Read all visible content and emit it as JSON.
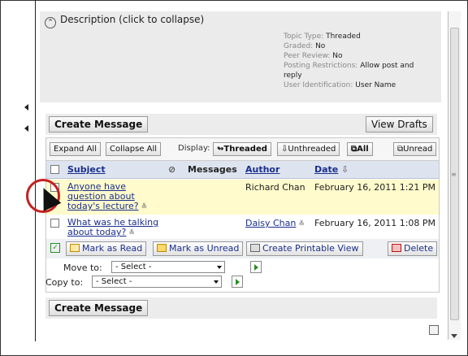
{
  "description": {
    "header": "Description (click to collapse)",
    "meta": [
      {
        "label": "Topic Type:",
        "value": "Threaded"
      },
      {
        "label": "Graded:",
        "value": "No"
      },
      {
        "label": "Peer Review:",
        "value": "No"
      },
      {
        "label": "Posting Restrictions:",
        "value": "Allow post and reply"
      },
      {
        "label": "User Identification:",
        "value": "User Name"
      }
    ]
  },
  "top_bar": {
    "create_label": "Create Message",
    "drafts_label": "View Drafts"
  },
  "toolbar": {
    "expand_all": "Expand All",
    "collapse_all": "Collapse All",
    "display_label": "Display:",
    "threaded": "Threaded",
    "unthreaded": "Unthreaded",
    "all": "All",
    "unread": "Unread"
  },
  "table": {
    "headers": {
      "subject": "Subject",
      "messages": "Messages",
      "author": "Author",
      "date": "Date"
    },
    "rows": [
      {
        "subject": "Anyone have question about today's lecture?",
        "author": "Richard Chan",
        "date": "February 16, 2011 1:21 PM"
      },
      {
        "subject": "What was he talking about today?",
        "author": "Daisy Chan",
        "date": "February 16, 2011 1:08 PM"
      }
    ]
  },
  "actions": {
    "mark_read": "Mark as Read",
    "mark_unread": "Mark as Unread",
    "printable": "Create Printable View",
    "delete": "Delete"
  },
  "move": {
    "label": "Move to:",
    "selected": "- Select -"
  },
  "copy": {
    "label": "Copy to:",
    "selected": "- Select -"
  },
  "bottom_bar": {
    "create_label": "Create Message"
  },
  "colors": {
    "link": "#1a2f8c",
    "highlight_row": "#fffbcc",
    "header_row": "#dde4ef",
    "callout": "#c62020"
  },
  "icons": [
    "collapse-icon",
    "threaded-icon",
    "unthreaded-icon",
    "all-icon",
    "unread-icon",
    "attachment-icon",
    "sort-down-icon",
    "reply-icon",
    "mark-read-icon",
    "mark-unread-icon",
    "printer-icon",
    "delete-icon",
    "go-arrow-icon",
    "cursor-icon"
  ]
}
